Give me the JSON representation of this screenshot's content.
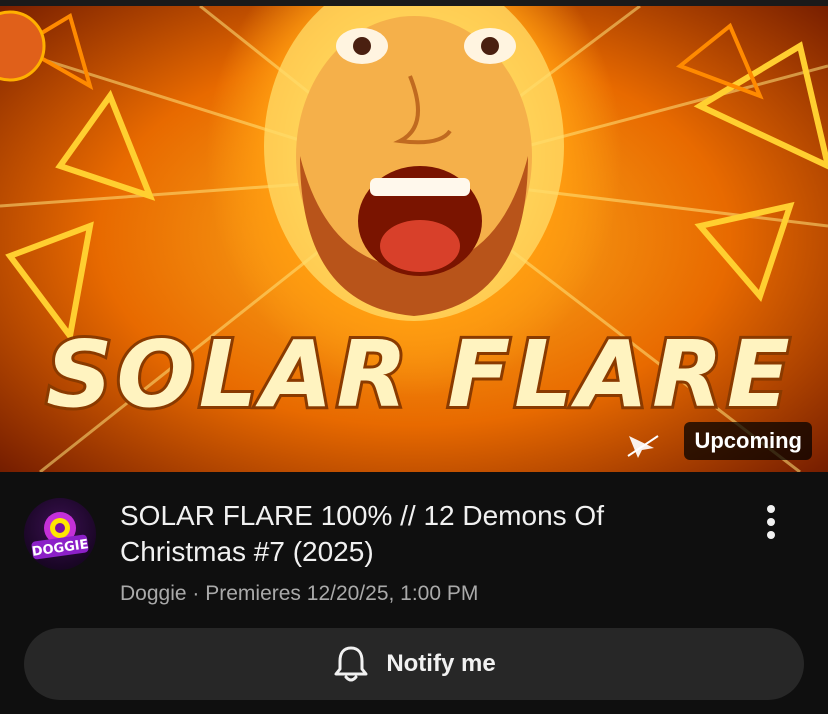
{
  "thumbnail": {
    "overlay_title": "SOLAR FLARE",
    "badge": "Upcoming"
  },
  "channel": {
    "avatar_text": "DOGGIE"
  },
  "video": {
    "title": "SOLAR FLARE 100% // 12 Demons Of Christmas #7 (2025)",
    "channel_name": "Doggie",
    "separator": " · ",
    "premiere": "Premieres 12/20/25, 1:00 PM"
  },
  "actions": {
    "notify_label": "Notify me"
  },
  "icons": {
    "cast": "cast-icon",
    "more": "more-vert-icon",
    "bell": "bell-icon"
  },
  "colors": {
    "background": "#0f0f0f",
    "button": "#272727",
    "text": "#f1f1f1",
    "muted_text": "#aaaaaa",
    "sun_orange": "#ff9c10"
  }
}
